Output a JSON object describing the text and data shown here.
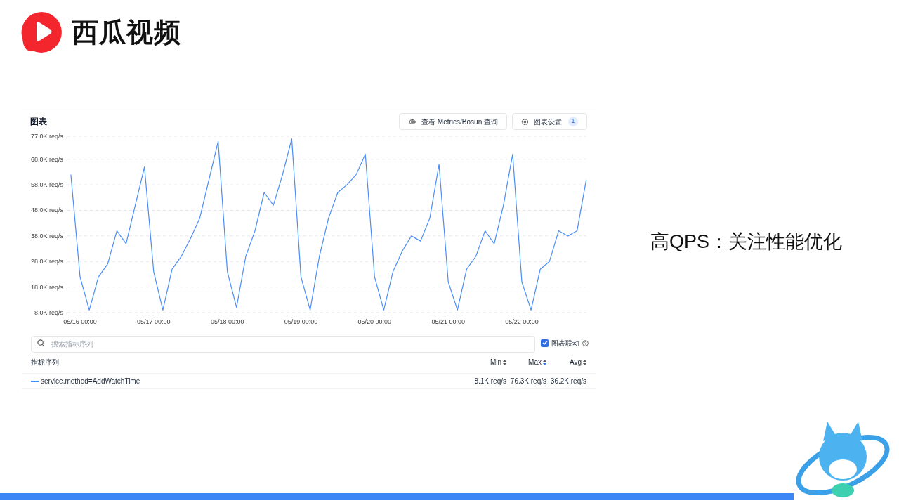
{
  "logo": {
    "text": "西瓜视频"
  },
  "panel": {
    "title": "图表",
    "buttons": [
      {
        "kind": "eye",
        "label": "查看 Metrics/Bosun 查询"
      },
      {
        "kind": "gear",
        "label": "图表设置",
        "badge": "1"
      }
    ],
    "chart_data": {
      "type": "line",
      "grid": true,
      "ylim": [
        8,
        77
      ],
      "categories": [
        null,
        "05/16 00:00",
        null,
        null,
        null,
        null,
        null,
        null,
        null,
        "05/17 00:00",
        null,
        null,
        null,
        null,
        null,
        null,
        null,
        "05/18 00:00",
        null,
        null,
        null,
        null,
        null,
        null,
        null,
        "05/19 00:00",
        null,
        null,
        null,
        null,
        null,
        null,
        null,
        "05/20 00:00",
        null,
        null,
        null,
        null,
        null,
        null,
        null,
        "05/21 00:00",
        null,
        null,
        null,
        null,
        null,
        null,
        null,
        "05/22 00:00",
        null,
        null,
        null,
        null,
        null,
        null,
        null
      ],
      "yticks": [
        {
          "value": 8,
          "label": "8.0K req/s"
        },
        {
          "value": 18,
          "label": "18.0K req/s"
        },
        {
          "value": 28,
          "label": "28.0K req/s"
        },
        {
          "value": 38,
          "label": "38.0K req/s"
        },
        {
          "value": 48,
          "label": "48.0K req/s"
        },
        {
          "value": 58,
          "label": "58.0K req/s"
        },
        {
          "value": 68,
          "label": "68.0K req/s"
        },
        {
          "value": 77,
          "label": "77.0K req/s"
        }
      ],
      "series": [
        {
          "name": "service.method=AddWatchTime",
          "color": "#4a8df8",
          "values": [
            62,
            22,
            9,
            22,
            27,
            40,
            35,
            50,
            65,
            24,
            9,
            25,
            30,
            37,
            45,
            60,
            75,
            24,
            10,
            30,
            40,
            55,
            50,
            62,
            76,
            22,
            9,
            30,
            45,
            55,
            58,
            62,
            70,
            22,
            9,
            24,
            32,
            38,
            36,
            45,
            66,
            20,
            9,
            25,
            30,
            40,
            35,
            50,
            70,
            20,
            9,
            25,
            28,
            40,
            38,
            40,
            60
          ]
        }
      ]
    },
    "search": {
      "placeholder": "搜索指标序列"
    },
    "link_charts": {
      "label": "图表联动",
      "checked": true
    },
    "table": {
      "columns": [
        {
          "label": "指标序列"
        },
        {
          "label": "Min",
          "sorted_desc": false
        },
        {
          "label": "Max",
          "sorted_desc": true
        },
        {
          "label": "Avg",
          "sorted_desc": false
        }
      ],
      "rows": [
        {
          "min": "8.1K req/s",
          "max": "76.3K req/s",
          "avg": "36.2K req/s"
        }
      ]
    }
  },
  "headline": "高QPS：关注性能优化"
}
